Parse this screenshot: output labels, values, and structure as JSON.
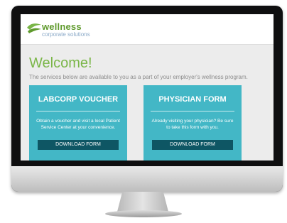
{
  "header": {
    "logo_title": "wellness",
    "logo_subtitle": "corporate solutions"
  },
  "main": {
    "welcome_title": "Welcome!",
    "welcome_text": "The services below are available to you as a part of your employer's wellness program."
  },
  "cards": [
    {
      "title": "LABCORP VOUCHER",
      "description": "Obtain a voucher and visit a local Patient Service Center at your convenience.",
      "button_label": "DOWNLOAD FORM"
    },
    {
      "title": "PHYSICIAN FORM",
      "description": "Already visiting your physician? Be sure to take this form with you.",
      "button_label": "DOWNLOAD FORM"
    }
  ],
  "colors": {
    "brand_green": "#7ab648",
    "card_teal": "#43b7c6",
    "button_dark": "#0e5664"
  }
}
